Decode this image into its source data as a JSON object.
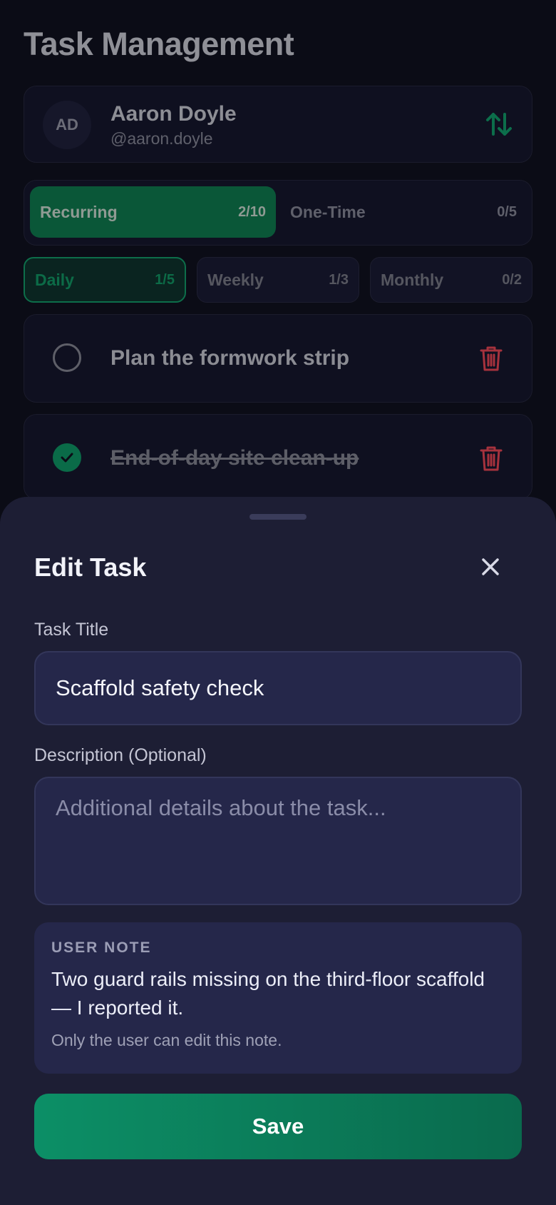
{
  "page": {
    "title": "Task Management"
  },
  "user": {
    "initials": "AD",
    "name": "Aaron Doyle",
    "handle": "@aaron.doyle"
  },
  "segments": [
    {
      "label": "Recurring",
      "count": "2/10",
      "active": true
    },
    {
      "label": "One-Time",
      "count": "0/5",
      "active": false
    }
  ],
  "subtabs": [
    {
      "label": "Daily",
      "count": "1/5",
      "active": true
    },
    {
      "label": "Weekly",
      "count": "1/3",
      "active": false
    },
    {
      "label": "Monthly",
      "count": "0/2",
      "active": false
    }
  ],
  "tasks": [
    {
      "title": "Plan the formwork strip",
      "done": false
    },
    {
      "title": "End-of-day site clean-up",
      "done": true
    }
  ],
  "sheet": {
    "title": "Edit Task",
    "task_title_label": "Task Title",
    "task_title_value": "Scaffold safety check",
    "description_label": "Description (Optional)",
    "description_placeholder": "Additional details about the task...",
    "note_label": "USER NOTE",
    "note_text": "Two guard rails missing on the third-floor scaffold — I reported it.",
    "note_footer": "Only the user can edit this note.",
    "save_label": "Save"
  },
  "colors": {
    "accent": "#0c8f66",
    "danger": "#a6323d",
    "sheet_bg": "#1d1e34"
  },
  "icons": {
    "sort": "sort-arrows-icon",
    "check": "check-icon",
    "delete": "trash-icon",
    "close": "close-icon"
  }
}
